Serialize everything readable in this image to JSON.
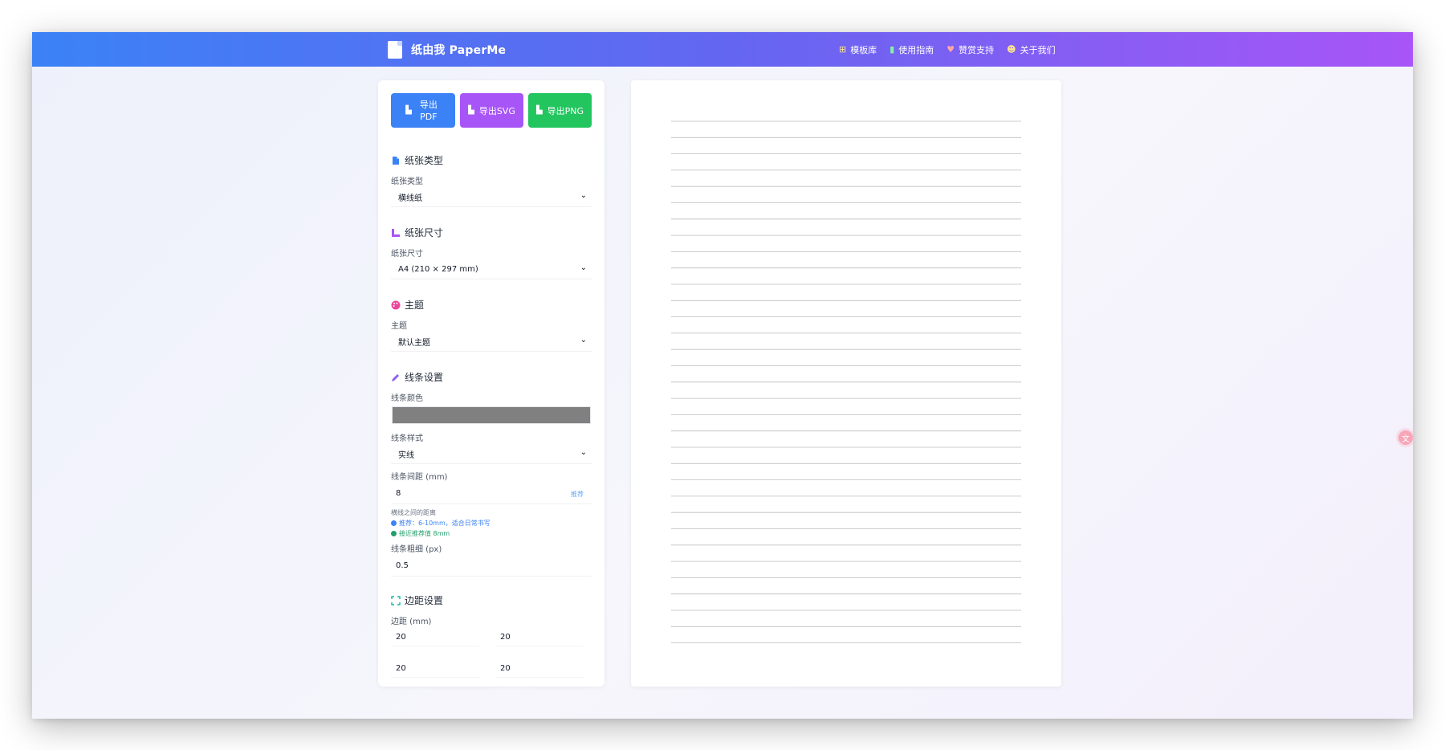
{
  "header": {
    "brand": "纸由我 PaperMe",
    "nav": [
      {
        "label": "模板库",
        "icon": "grid-icon",
        "color": "#fde68a"
      },
      {
        "label": "使用指南",
        "icon": "book-icon",
        "color": "#86efac"
      },
      {
        "label": "赞赏支持",
        "icon": "heart-icon",
        "color": "#fca5a5"
      },
      {
        "label": "关于我们",
        "icon": "users-icon",
        "color": "#fde68a"
      }
    ]
  },
  "toolbar": {
    "export_pdf": "导出PDF",
    "export_svg": "导出SVG",
    "export_png": "导出PNG"
  },
  "sections": {
    "paper_type": {
      "title": "纸张类型",
      "label": "纸张类型",
      "value": "横线纸"
    },
    "paper_size": {
      "title": "纸张尺寸",
      "label": "纸张尺寸",
      "value": "A4 (210 × 297 mm)"
    },
    "theme": {
      "title": "主题",
      "label": "主题",
      "value": "默认主题"
    },
    "line": {
      "title": "线条设置",
      "color_label": "线条颜色",
      "color": "#808080",
      "style_label": "线条样式",
      "style_value": "实线",
      "spacing_label": "线条间距 (mm)",
      "spacing_value": "8",
      "spacing_tag": "推荐",
      "hint_desc": "横线之间的距离",
      "hint_recommend": "推荐：6-10mm，适合日常书写",
      "hint_ok": "接近推荐值 8mm",
      "width_label": "线条粗细 (px)",
      "width_value": "0.5"
    },
    "margin": {
      "title": "边距设置",
      "label": "边距 (mm)",
      "top": "20",
      "right": "20",
      "bottom": "20",
      "left": "20"
    }
  },
  "preview": {
    "line_count": 33,
    "line_color": "#bdbdbd"
  },
  "colors": {
    "accent_blue": "#3b82f6",
    "accent_purple": "#a855f7",
    "accent_green": "#22c55e"
  }
}
